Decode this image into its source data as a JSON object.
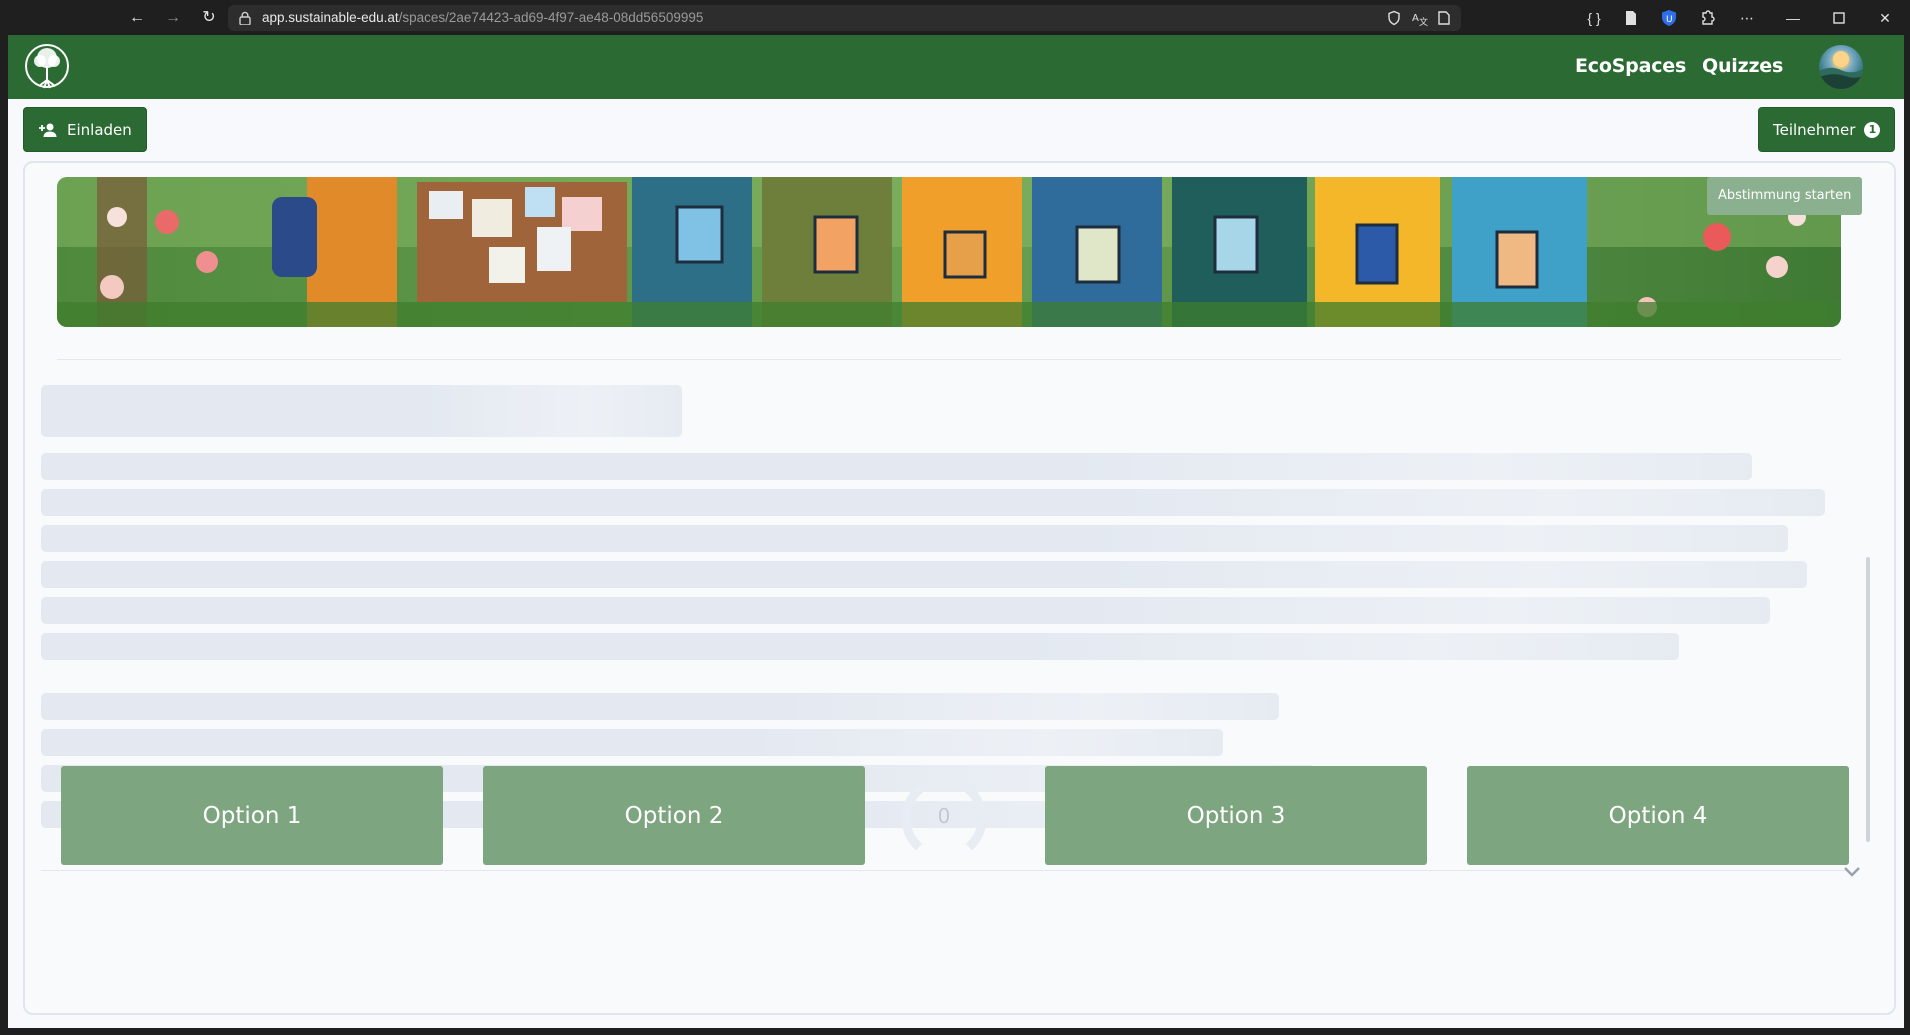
{
  "browser": {
    "url_host": "app.sustainable-edu.at",
    "url_path": "/spaces/2ae74423-ad69-4f97-ae48-08dd56509995"
  },
  "header": {
    "nav": [
      {
        "label": "EcoSpaces"
      },
      {
        "label": "Quizzes"
      }
    ],
    "brand_color": "#2b6b33"
  },
  "toolbar": {
    "invite_label": "Einladen",
    "participants_label": "Teilnehmer",
    "participants_count": "1"
  },
  "banner": {
    "start_vote_label": "Abstimmung starten"
  },
  "vote": {
    "options": [
      {
        "label": "Option 1"
      },
      {
        "label": "Option 2"
      },
      {
        "label": "Option 3"
      },
      {
        "label": "Option 4"
      }
    ],
    "counter": "0",
    "option_color": "#7da57f"
  }
}
